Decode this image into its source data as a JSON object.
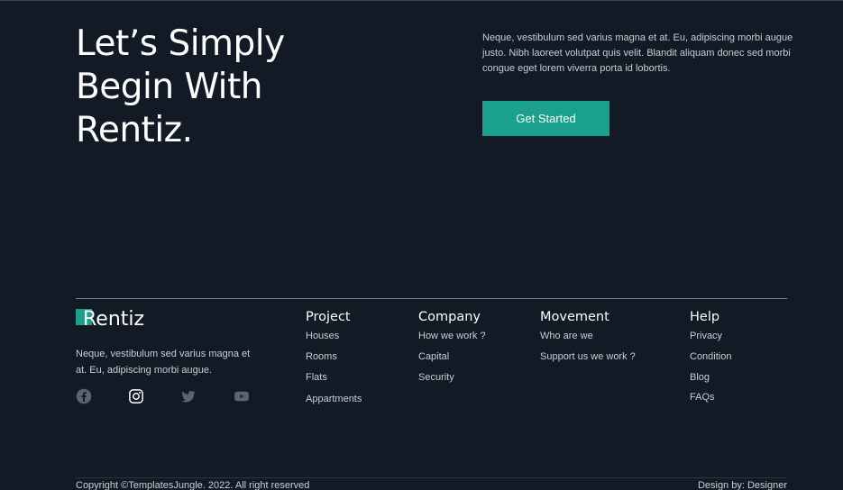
{
  "cta": {
    "title_lines": [
      "Let’s Simply",
      "Begin With",
      "Rentiz."
    ],
    "text": "Neque, vestibulum sed varius magna et at. Eu, adipiscing morbi augue justo. Nibh laoreet volutpat quis velit. Blandit aliquam donec sed morbi congue eget lorem viverra porta id lobortis.",
    "button_label": "Get Started"
  },
  "footer": {
    "brand": "Rentiz",
    "about": "Neque, vestibulum sed varius magna et at. Eu, adipiscing morbi augue.",
    "socials": [
      "facebook-icon",
      "instagram-icon",
      "twitter-icon",
      "youtube-icon"
    ],
    "columns": [
      {
        "title": "Project",
        "links": [
          "Houses",
          "Rooms",
          "Flats",
          "Appartments"
        ]
      },
      {
        "title": "Company",
        "links": [
          "How we work ?",
          "Capital",
          "Security"
        ]
      },
      {
        "title": "Movement",
        "links": [
          "Who are we",
          "Support us we work ?"
        ]
      },
      {
        "title": "Help",
        "links": [
          "Privacy",
          "Condition",
          "Blog",
          "FAQs"
        ]
      }
    ],
    "copyright": "Copyright ©TemplatesJungle. 2022. All right reserved",
    "designer": "Design by: Designer"
  },
  "colors": {
    "background": "#121a25",
    "accent": "#1aa08c",
    "text_muted": "#c9ced6"
  }
}
